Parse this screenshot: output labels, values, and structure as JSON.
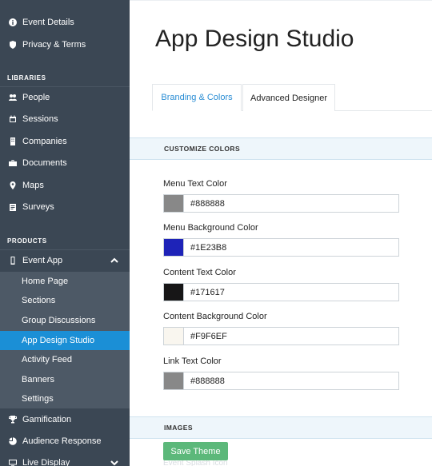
{
  "sidebar": {
    "top_items": [
      {
        "label": "Event Details",
        "icon": "info-icon"
      },
      {
        "label": "Privacy & Terms",
        "icon": "shield-icon"
      }
    ],
    "libraries_heading": "LIBRARIES",
    "libraries": [
      {
        "label": "People",
        "icon": "people-icon"
      },
      {
        "label": "Sessions",
        "icon": "calendar-icon"
      },
      {
        "label": "Companies",
        "icon": "building-icon"
      },
      {
        "label": "Documents",
        "icon": "briefcase-icon"
      },
      {
        "label": "Maps",
        "icon": "map-pin-icon"
      },
      {
        "label": "Surveys",
        "icon": "clipboard-icon"
      }
    ],
    "products_heading": "PRODUCTS",
    "event_app": {
      "label": "Event App",
      "icon": "mobile-icon"
    },
    "event_app_sub": [
      {
        "label": "Home Page"
      },
      {
        "label": "Sections"
      },
      {
        "label": "Group Discussions"
      },
      {
        "label": "App Design Studio",
        "active": true
      },
      {
        "label": "Activity Feed"
      },
      {
        "label": "Banners"
      },
      {
        "label": "Settings"
      }
    ],
    "products": [
      {
        "label": "Gamification",
        "icon": "trophy-icon"
      },
      {
        "label": "Audience Response",
        "icon": "pie-chart-icon"
      },
      {
        "label": "Live Display",
        "icon": "monitor-icon"
      }
    ]
  },
  "main": {
    "title": "App Design Studio",
    "tabs": [
      {
        "label": "Branding & Colors",
        "active": true
      },
      {
        "label": "Advanced Designer",
        "active": false
      }
    ],
    "customize_heading": "CUSTOMIZE COLORS",
    "color_fields": [
      {
        "label": "Menu Text Color",
        "value": "#888888",
        "swatch": "#888888"
      },
      {
        "label": "Menu Background Color",
        "value": "#1E23B8",
        "swatch": "#1E23B8"
      },
      {
        "label": "Content Text Color",
        "value": "#171617",
        "swatch": "#171617"
      },
      {
        "label": "Content Background Color",
        "value": "#F9F6EF",
        "swatch": "#F9F6EF"
      },
      {
        "label": "Link Text Color",
        "value": "#888888",
        "swatch": "#888888"
      }
    ],
    "images_heading": "IMAGES",
    "save_button": "Save Theme",
    "cutoff_label": "Event Splash Icon"
  },
  "colors": {
    "sidebar_bg": "#3b4754",
    "sidebar_sub_bg": "#4d5966",
    "active_item": "#1b8fd6",
    "accent_tab": "#2a8dd4",
    "save_button": "#5cb87a"
  }
}
